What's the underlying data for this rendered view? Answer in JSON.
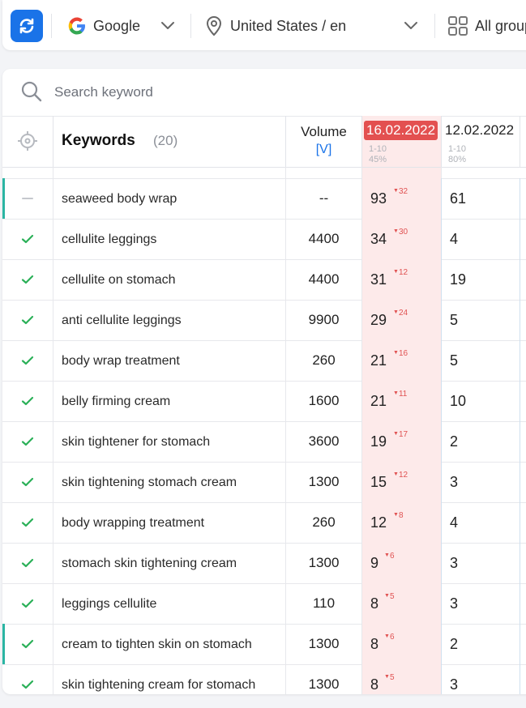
{
  "toolbar": {
    "engine": "Google",
    "location": "United States / en",
    "groups": "All groups"
  },
  "search": {
    "placeholder": "Search keyword",
    "value": ""
  },
  "table_header": {
    "keywords_label": "Keywords",
    "keywords_count": "(20)",
    "volume_label": "Volume",
    "volume_sub": "[V]",
    "date_current": "16.02.2022",
    "date_current_range": "1-10",
    "date_current_pct": "45%",
    "date_prev": "12.02.2022",
    "date_prev_range": "1-10",
    "date_prev_pct": "80%"
  },
  "colors": {
    "accent": "#1a73e8",
    "highlight": "#e35050",
    "check": "#2bb058",
    "row_marker": "#2bb5a3",
    "cell_bg": "#fdeaea"
  },
  "rows": [
    {
      "status": "dash",
      "keyword": "seaweed body wrap",
      "volume": "--",
      "pos": "93",
      "change": "32",
      "prev": "61",
      "marker": true
    },
    {
      "status": "check",
      "keyword": "cellulite leggings",
      "volume": "4400",
      "pos": "34",
      "change": "30",
      "prev": "4",
      "marker": false
    },
    {
      "status": "check",
      "keyword": "cellulite on stomach",
      "volume": "4400",
      "pos": "31",
      "change": "12",
      "prev": "19",
      "marker": false
    },
    {
      "status": "check",
      "keyword": "anti cellulite leggings",
      "volume": "9900",
      "pos": "29",
      "change": "24",
      "prev": "5",
      "marker": false
    },
    {
      "status": "check",
      "keyword": "body wrap treatment",
      "volume": "260",
      "pos": "21",
      "change": "16",
      "prev": "5",
      "marker": false
    },
    {
      "status": "check",
      "keyword": "belly firming cream",
      "volume": "1600",
      "pos": "21",
      "change": "11",
      "prev": "10",
      "marker": false
    },
    {
      "status": "check",
      "keyword": "skin tightener for stomach",
      "volume": "3600",
      "pos": "19",
      "change": "17",
      "prev": "2",
      "marker": false
    },
    {
      "status": "check",
      "keyword": "skin tightening stomach cream",
      "volume": "1300",
      "pos": "15",
      "change": "12",
      "prev": "3",
      "marker": false
    },
    {
      "status": "check",
      "keyword": "body wrapping treatment",
      "volume": "260",
      "pos": "12",
      "change": "8",
      "prev": "4",
      "marker": false
    },
    {
      "status": "check",
      "keyword": "stomach skin tightening cream",
      "volume": "1300",
      "pos": "9",
      "change": "6",
      "prev": "3",
      "marker": false
    },
    {
      "status": "check",
      "keyword": "leggings cellulite",
      "volume": "110",
      "pos": "8",
      "change": "5",
      "prev": "3",
      "marker": false
    },
    {
      "status": "check",
      "keyword": "cream to tighten skin on stomach",
      "volume": "1300",
      "pos": "8",
      "change": "6",
      "prev": "2",
      "marker": true
    },
    {
      "status": "check",
      "keyword": "skin tightening cream for stomach",
      "volume": "1300",
      "pos": "8",
      "change": "5",
      "prev": "3",
      "marker": false
    }
  ]
}
